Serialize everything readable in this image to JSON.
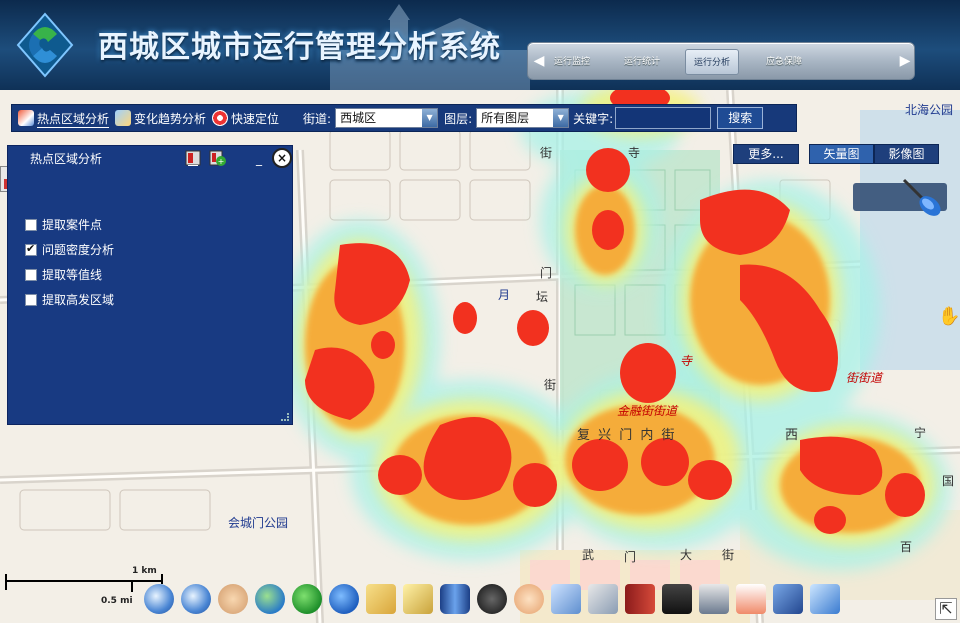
{
  "header": {
    "app_title": "西城区城市运行管理分析系统",
    "nav_tabs": [
      "运行监控",
      "运行统计",
      "运行分析",
      "应急保障"
    ],
    "active_tab": "运行分析"
  },
  "toolbar": {
    "tools": [
      {
        "label": "热点区域分析",
        "icon": "map-hotspot-icon"
      },
      {
        "label": "变化趋势分析",
        "icon": "pen-trend-icon"
      },
      {
        "label": "快速定位",
        "icon": "target-icon"
      }
    ],
    "street_label": "街道:",
    "street_value": "西城区",
    "layer_label": "图层:",
    "layer_value": "所有图层",
    "keyword_label": "关键字:",
    "keyword_value": "",
    "search_label": "搜索"
  },
  "map_controls": {
    "more_label": "更多...",
    "basemaps": [
      "矢量图",
      "影像图"
    ],
    "active_basemap": "矢量图"
  },
  "panel": {
    "title": "热点区域分析",
    "options": [
      {
        "label": "提取案件点",
        "checked": false
      },
      {
        "label": "问题密度分析",
        "checked": true
      },
      {
        "label": "提取等值线",
        "checked": false
      },
      {
        "label": "提取高发区域",
        "checked": false
      }
    ],
    "minimize_label": "_",
    "close_label": "×"
  },
  "map_labels": {
    "beihai": "北海公园",
    "temple": "寺",
    "men": "门",
    "yue": "月",
    "tan": "坛",
    "jie1": "街",
    "jie2": "街",
    "si2": "寺",
    "jiedao_right": "街街道",
    "jinrong": "金融街街道",
    "fuxingmennei": "复 兴 门 内  街",
    "xi": "西",
    "gongyuan": "会城门公园",
    "wu": "武",
    "men2": "门",
    "da": "大",
    "jie3": "街",
    "bai": "百",
    "guo": "国",
    "wen": "宁"
  },
  "scale": {
    "top": "1 km",
    "bottom": "0.5 mi"
  },
  "bottom_tools": [
    "zoom-in-icon",
    "zoom-out-icon",
    "pan-hand-icon",
    "full-extent-icon",
    "back-icon",
    "forward-icon",
    "measure-length-icon",
    "measure-area-icon",
    "layer-icon",
    "binoculars-icon",
    "identify-icon",
    "edit-icon",
    "draw-icon",
    "bookmark-icon",
    "save-icon",
    "print-icon",
    "export-icon",
    "3d-icon",
    "overview-icon"
  ]
}
